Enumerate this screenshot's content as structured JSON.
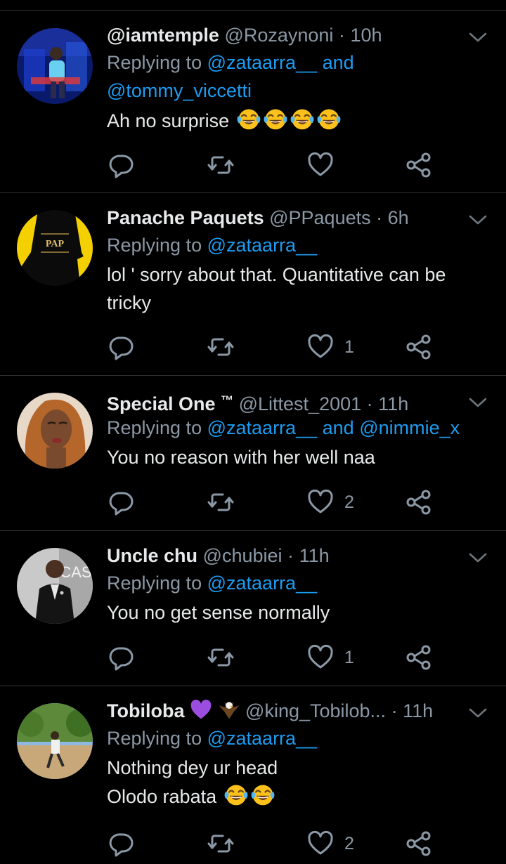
{
  "tweets": [
    {
      "name": "@iamtemple",
      "handle": "@Rozaynoni",
      "time": "10h",
      "replying_prefix": "Replying to",
      "mention1": "@zataarra__",
      "conj": "and",
      "mention2": "@tommy_viccetti",
      "text": "Ah no surprise",
      "emoji_count": 4,
      "likes": ""
    },
    {
      "name": "Panache Paquets",
      "handle": "@PPaquets",
      "time": "6h",
      "replying_prefix": "Replying to",
      "mention1": "@zataarra__",
      "text_line1": "lol ' sorry about that. Quantitative  can be",
      "text_line2": "tricky",
      "avatar_text": "PAP",
      "likes": "1"
    },
    {
      "name": "Special One",
      "name_suffix": "™",
      "handle": "@Littest_2001",
      "time": "11h",
      "replying_prefix": "Replying to",
      "mention1": "@zataarra__",
      "conj": "and",
      "mention2": "@nimmie_x",
      "text": "You no reason with her well naa",
      "likes": "2"
    },
    {
      "name": "Uncle chu",
      "handle": "@chubiei",
      "time": "11h",
      "replying_prefix": "Replying to",
      "mention1": "@zataarra__",
      "text": "You no get sense normally",
      "avatar_text": "CAS",
      "likes": "1"
    },
    {
      "name": "Tobiloba",
      "handle": "@king_Tobilob...",
      "time": "11h",
      "replying_prefix": "Replying to",
      "mention1": "@zataarra__",
      "text_line1": "Nothing dey ur head",
      "text_line2": "Olodo rabata",
      "emoji_count": 2,
      "likes": "2"
    }
  ],
  "dot": "·",
  "icons": [
    "reply-icon",
    "retweet-icon",
    "like-icon",
    "share-icon",
    "chevron-down-icon",
    "tears-of-joy-emoji",
    "purple-heart-emoji",
    "eagle-emoji"
  ],
  "colors": {
    "background": "#000000",
    "name": "#e7e9ea",
    "meta": "#8b98a5",
    "mention": "#1d9bf0",
    "divider": "#2f3336",
    "purple_heart": "#9b4de0"
  }
}
